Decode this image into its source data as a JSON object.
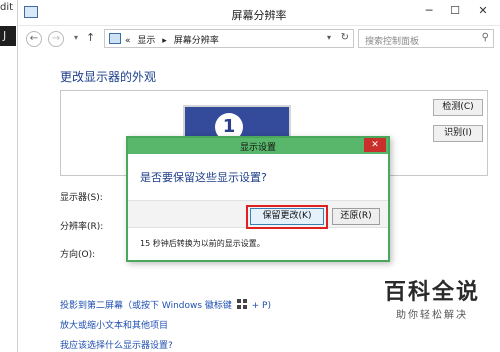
{
  "background_editor": {
    "label": "dit",
    "badge": "J"
  },
  "window": {
    "title": "屏幕分辨率",
    "minimize": "─",
    "maximize": "☐",
    "close": "✕"
  },
  "address_bar": {
    "back": "←",
    "forward": "→",
    "up": "↑",
    "chevrons": "«",
    "crumbs": [
      "显示",
      "屏幕分辨率"
    ],
    "search_placeholder": "搜索控制面板"
  },
  "main": {
    "heading": "更改显示器的外观",
    "monitor_number": "1",
    "detect_button": "检测(C)",
    "identify_button": "识别(I)",
    "fields": {
      "display_label": "显示器(S):",
      "resolution_label": "分辨率(R):",
      "orientation_label": "方向(O):"
    },
    "links": {
      "project": "投影到第二屏幕（或按下 Windows 徽标键",
      "project_suffix": "+ P)",
      "enlarge": "放大或缩小文本和其他项目",
      "which_settings": "我应该选择什么显示器设置?"
    }
  },
  "dialog": {
    "title": "显示设置",
    "close": "✕",
    "question": "是否要保留这些显示设置?",
    "keep_button": "保留更改(K)",
    "revert_button": "还原(R)",
    "countdown": "15 秒钟后转换为以前的显示设置。"
  },
  "watermark": {
    "title": "百科全说",
    "subtitle": "助你轻松解决"
  },
  "colors": {
    "dialog_border": "#49a85b",
    "highlight": "#e02020",
    "link": "#1f4fb0",
    "heading": "#1e3f8a"
  }
}
